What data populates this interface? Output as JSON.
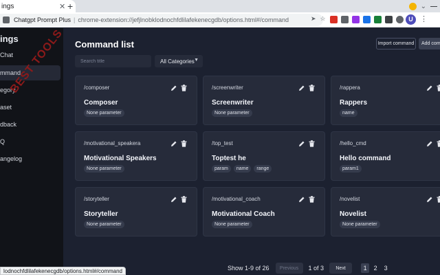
{
  "browser": {
    "tab_title": "ings",
    "omnibox_host": "Chatgpt Prompt Plus",
    "omnibox_url": "chrome-extension://jefjlnobklodnochfdlilafekenecgdb/options.html#/command",
    "avatar_letter": "U",
    "status_url": "lodnochfdlilafekenecgdb/options.html#/command"
  },
  "sidebar": {
    "title": "ings",
    "items": [
      {
        "label": "Chat"
      },
      {
        "label": "mmand"
      },
      {
        "label": "egory"
      },
      {
        "label": "aset"
      },
      {
        "label": "dback"
      },
      {
        "label": "Q"
      },
      {
        "label": "angelog"
      }
    ]
  },
  "header": {
    "title": "Command list",
    "import_label": "Import command",
    "add_label": "Add comm"
  },
  "filters": {
    "search_placeholder": "Search title",
    "category_value": "All Categories"
  },
  "cards": [
    {
      "command": "/composer",
      "title": "Composer",
      "tags": [
        "None parameter"
      ]
    },
    {
      "command": "/screenwriter",
      "title": "Screenwriter",
      "tags": [
        "None parameter"
      ]
    },
    {
      "command": "/rappera",
      "title": "Rappers",
      "tags": [
        "name"
      ]
    },
    {
      "command": "/motivational_speakera",
      "title": "Motivational Speakers",
      "tags": [
        "None parameter"
      ]
    },
    {
      "command": "/top_test",
      "title": "Toptest he",
      "tags": [
        "param",
        "name",
        "range"
      ]
    },
    {
      "command": "/hello_cmd",
      "title": "Hello command",
      "tags": [
        "param1"
      ]
    },
    {
      "command": "/storyteller",
      "title": "Storyteller",
      "tags": [
        "None parameter"
      ]
    },
    {
      "command": "/motivational_coach",
      "title": "Motivational Coach",
      "tags": [
        "None parameter"
      ]
    },
    {
      "command": "/novelist",
      "title": "Novelist",
      "tags": [
        "None parameter"
      ]
    }
  ],
  "pagination": {
    "summary": "Show 1-9 of 26",
    "prev_label": "Previous",
    "page_of": "1 of 3",
    "next_label": "Next",
    "pages": [
      "1",
      "2",
      "3"
    ]
  },
  "watermark": "BEST TOOLS",
  "colors": {
    "accent": "#4e4dba",
    "sidebar_bg": "#111318",
    "main_bg": "#1c2130",
    "card_bg": "#262b3a",
    "watermark": "#8b1a1a"
  }
}
